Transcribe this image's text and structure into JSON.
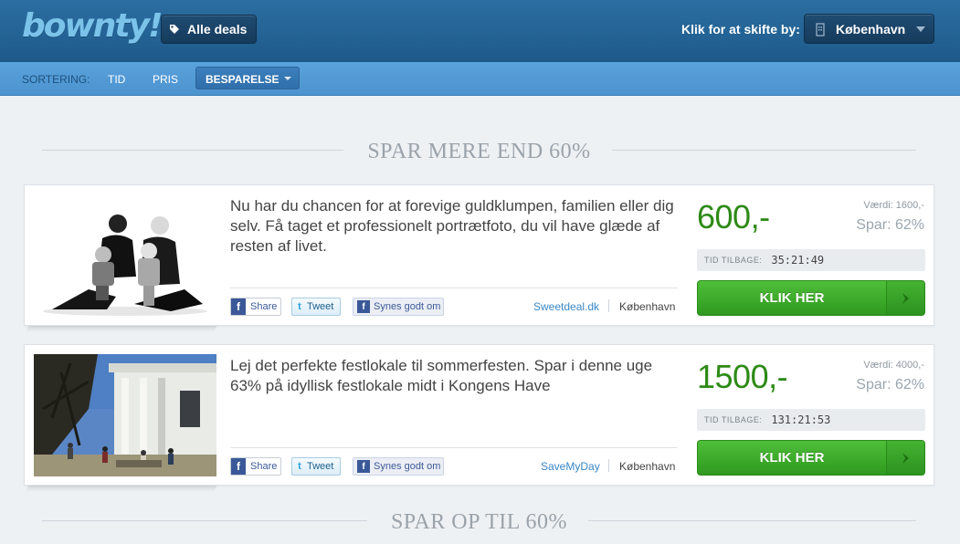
{
  "header": {
    "logo_text": "bownty!",
    "deals_button": "Alle deals",
    "city_switch_label": "Klik for at skifte by:",
    "city": "København"
  },
  "sortbar": {
    "label": "SORTERING:",
    "options": [
      "TID",
      "PRIS"
    ],
    "active": "BESPARELSE"
  },
  "sections": [
    {
      "title": "SPAR MERE END 60%"
    },
    {
      "title": "SPAR OP TIL 60%"
    }
  ],
  "deals": [
    {
      "description": "Nu har du chancen for at forevige guldklumpen, familien eller dig selv. Få taget et professionelt portrætfoto, du vil have glæde af resten af livet.",
      "price": "600,-",
      "value": "Værdi: 1600,-",
      "save": "Spar: 62%",
      "timer_label": "TID TILBAGE:",
      "timer": "35:21:49",
      "button": "KLIK HER",
      "share": "Share",
      "tweet": "Tweet",
      "like": "Synes godt om",
      "source": "Sweetdeal.dk",
      "city": "København"
    },
    {
      "description": "Lej det perfekte festlokale til sommerfesten. Spar i denne uge 63% på idyllisk festlokale midt i Kongens Have",
      "price": "1500,-",
      "value": "Værdi: 4000,-",
      "save": "Spar: 62%",
      "timer_label": "TID TILBAGE:",
      "timer": "131:21:53",
      "button": "KLIK HER",
      "share": "Share",
      "tweet": "Tweet",
      "like": "Synes godt om",
      "source": "SaveMyDay",
      "city": "København"
    }
  ],
  "colors": {
    "header": "#1d5a8a",
    "sortbar": "#4c93cf",
    "price_green": "#2d8a16",
    "button_green": "#3aa828",
    "link_blue": "#3a87c8"
  }
}
